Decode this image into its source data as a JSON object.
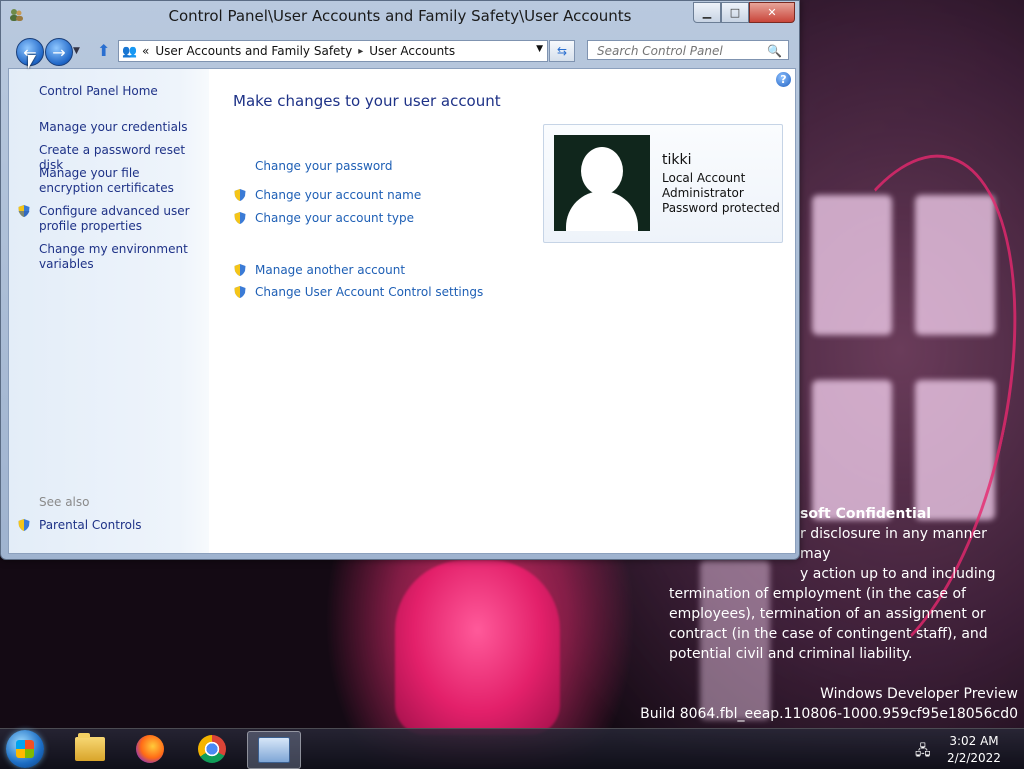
{
  "window": {
    "title": "Control Panel\\User Accounts and Family Safety\\User Accounts"
  },
  "address": {
    "prefix": "«",
    "crumbs": [
      "User Accounts and Family Safety",
      "User Accounts"
    ],
    "separator": "▸"
  },
  "search": {
    "placeholder": "Search Control Panel"
  },
  "left_pane": {
    "home": "Control Panel Home",
    "items": [
      "Manage your credentials",
      "Create a password reset disk",
      "Manage your file encryption certificates",
      "Configure advanced user profile properties",
      "Change my environment variables"
    ],
    "see_also_label": "See also",
    "see_also": [
      "Parental Controls"
    ]
  },
  "main": {
    "title": "Make changes to your user account",
    "links": [
      "Change your password",
      "Change your account name",
      "Change your account type",
      "Manage another account",
      "Change User Account Control settings"
    ]
  },
  "user": {
    "name": "tikki",
    "details": [
      "Local Account",
      "Administrator",
      "Password protected"
    ]
  },
  "desktop": {
    "confidential_title": "soft Confidential",
    "confidential_lines": [
      "r disclosure in any manner may",
      "y action up to and including",
      "termination of employment (in the case of",
      "employees), termination of an assignment or",
      "contract (in the case of contingent staff), and",
      "potential civil and criminal liability."
    ],
    "build_lines": [
      "Windows Developer Preview",
      "Build 8064.fbl_eeap.110806-1000.959cf95e18056cd0"
    ]
  },
  "taskbar": {
    "clock_time": "3:02 AM",
    "clock_date": "2/2/2022"
  },
  "colors": {
    "link": "#1e5fb5",
    "nav_text": "#1e3287"
  }
}
